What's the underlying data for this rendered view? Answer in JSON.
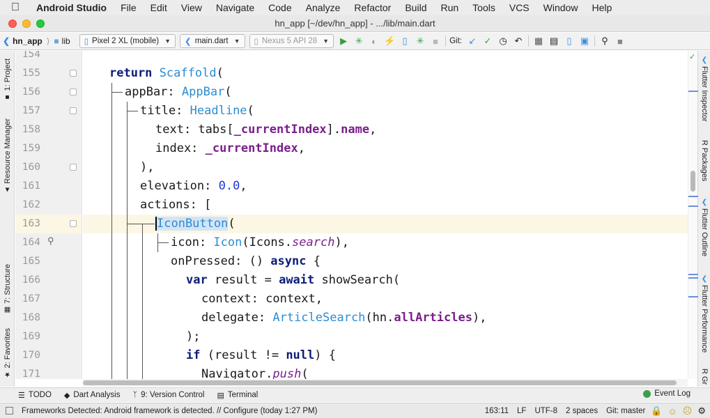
{
  "menubar": {
    "app": "Android Studio",
    "items": [
      "File",
      "Edit",
      "View",
      "Navigate",
      "Code",
      "Analyze",
      "Refactor",
      "Build",
      "Run",
      "Tools",
      "VCS",
      "Window",
      "Help"
    ]
  },
  "window": {
    "title": "hn_app [~/dev/hn_app] - .../lib/main.dart"
  },
  "toolbar": {
    "project": "hn_app",
    "folder": "lib",
    "device": "Pixel 2 XL (mobile)",
    "run_config": "main.dart",
    "avd": "Nexus 5 API 28",
    "git_label": "Git:"
  },
  "left_tabs": [
    "1: Project",
    "Resource Manager",
    "7: Structure",
    "2: Favorites"
  ],
  "right_tabs": [
    "Flutter Inspector",
    "R Packages",
    "Flutter Outline",
    "Flutter Performance",
    "R Gr"
  ],
  "editor": {
    "line_numbers": [
      "154",
      "155",
      "156",
      "157",
      "158",
      "159",
      "160",
      "161",
      "162",
      "163",
      "164",
      "165",
      "166",
      "167",
      "168",
      "169",
      "170",
      "171"
    ],
    "current_line": "163",
    "lines": {
      "l155": {
        "kw": "return",
        "t1": "Scaffold",
        "p": "("
      },
      "l156": {
        "a": "appBar: ",
        "t1": "AppBar",
        "p": "("
      },
      "l157": {
        "a": "title: ",
        "t1": "Headline",
        "p": "("
      },
      "l158": {
        "a": "text: tabs[",
        "f": "_currentIndex",
        "b": "].",
        "f2": "name",
        "c": ","
      },
      "l159": {
        "a": "index: ",
        "f": "_currentIndex",
        "c": ","
      },
      "l160": {
        "a": "),"
      },
      "l161": {
        "a": "elevation: ",
        "n": "0.0",
        "c": ","
      },
      "l162": {
        "a": "actions: ["
      },
      "l163": {
        "t1": "IconButton",
        "p": "("
      },
      "l164": {
        "a": "icon: ",
        "t1": "Icon",
        "b": "(Icons.",
        "i": "search",
        "c": "),"
      },
      "l165": {
        "a": "onPressed: () ",
        "kw": "async",
        "c": " {"
      },
      "l166": {
        "kw": "var",
        "a": " result = ",
        "kw2": "await",
        "b": " showSearch("
      },
      "l167": {
        "a": "context: context,"
      },
      "l168": {
        "a": "delegate: ",
        "t1": "ArticleSearch",
        "b": "(hn.",
        "f": "allArticles",
        "c": "),"
      },
      "l169": {
        "a": ");"
      },
      "l170": {
        "kw": "if",
        "a": " (result != ",
        "kw2": "null",
        "c": ") {"
      },
      "l171": {
        "a": "Navigator.",
        "i": "push",
        "c": "("
      }
    }
  },
  "tool_windows": [
    "TODO",
    "Dart Analysis",
    "9: Version Control",
    "Terminal"
  ],
  "event_log": "Event Log",
  "status": {
    "message": "Frameworks Detected: Android framework is detected. // Configure (today 1:27 PM)",
    "position": "163:11",
    "line_sep": "LF",
    "encoding": "UTF-8",
    "indent": "2 spaces",
    "git_branch": "Git: master"
  }
}
